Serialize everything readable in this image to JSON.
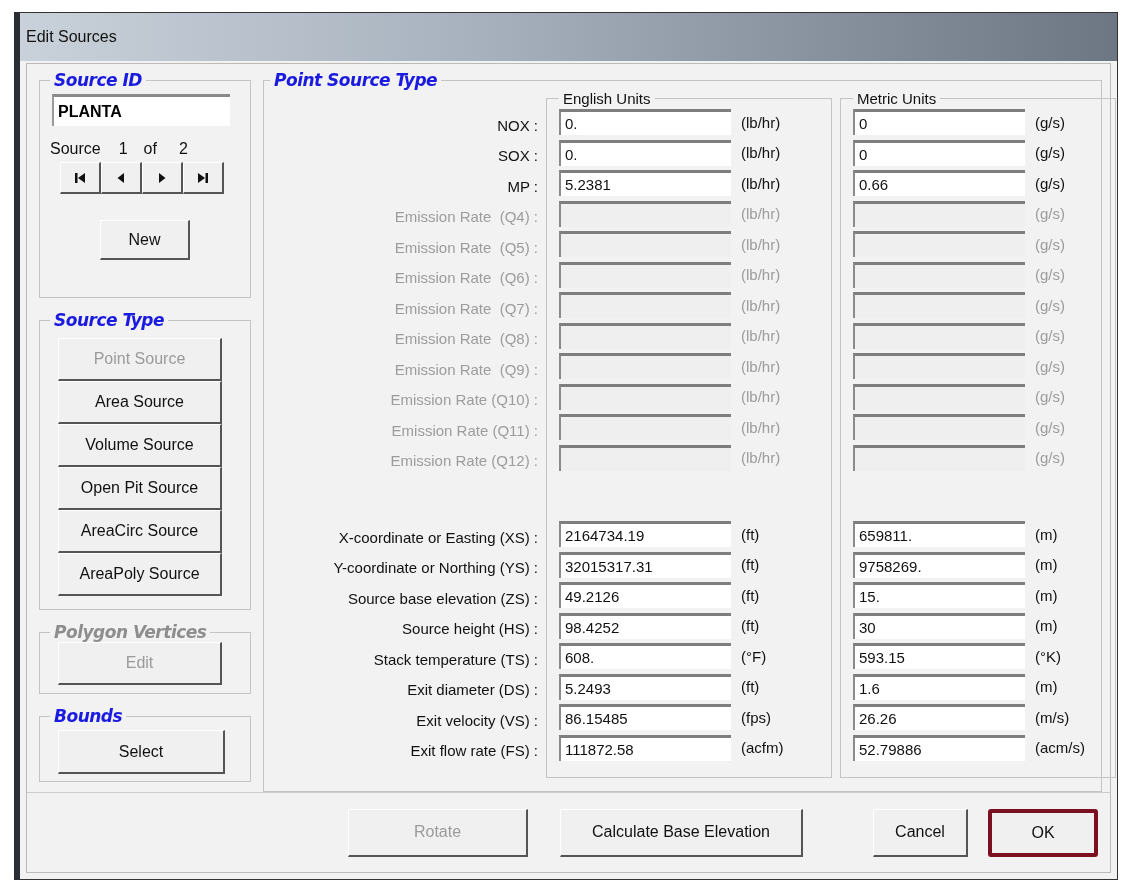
{
  "window": {
    "title": "Edit Sources"
  },
  "source_id": {
    "legend": "Source ID",
    "value": "PLANTA",
    "counter": {
      "label": "Source",
      "current": "1",
      "separator": "of",
      "total": "2"
    },
    "nav_buttons": [
      {
        "kind": "first"
      },
      {
        "kind": "prev"
      },
      {
        "kind": "next"
      },
      {
        "kind": "last"
      }
    ],
    "new_button": "New"
  },
  "source_type": {
    "legend": "Source Type",
    "buttons": [
      {
        "label": "Point Source",
        "disabled": true
      },
      {
        "label": "Area Source",
        "disabled": false
      },
      {
        "label": "Volume Source",
        "disabled": false
      },
      {
        "label": "Open Pit Source",
        "disabled": false
      },
      {
        "label": "AreaCirc Source",
        "disabled": false
      },
      {
        "label": "AreaPoly Source",
        "disabled": false
      }
    ]
  },
  "polygon_vertices": {
    "legend": "Polygon Vertices",
    "disabled": true,
    "button": "Edit"
  },
  "bounds": {
    "legend": "Bounds",
    "button": "Select"
  },
  "point_source": {
    "legend": "Point Source Type",
    "english_legend": "English Units",
    "metric_legend": "Metric Units",
    "emission_rows": [
      {
        "label": "NOX :",
        "english": "0.",
        "english_unit": "(lb/hr)",
        "metric": "0",
        "metric_unit": "(g/s)",
        "disabled": false
      },
      {
        "label": "SOX :",
        "english": "0.",
        "english_unit": "(lb/hr)",
        "metric": "0",
        "metric_unit": "(g/s)",
        "disabled": false
      },
      {
        "label": "MP :",
        "english": "5.2381",
        "english_unit": "(lb/hr)",
        "metric": "0.66",
        "metric_unit": "(g/s)",
        "disabled": false
      },
      {
        "label": "Emission Rate  (Q4) :",
        "english_unit": "(lb/hr)",
        "metric_unit": "(g/s)",
        "disabled": true
      },
      {
        "label": "Emission Rate  (Q5) :",
        "english_unit": "(lb/hr)",
        "metric_unit": "(g/s)",
        "disabled": true
      },
      {
        "label": "Emission Rate  (Q6) :",
        "english_unit": "(lb/hr)",
        "metric_unit": "(g/s)",
        "disabled": true
      },
      {
        "label": "Emission Rate  (Q7) :",
        "english_unit": "(lb/hr)",
        "metric_unit": "(g/s)",
        "disabled": true
      },
      {
        "label": "Emission Rate  (Q8) :",
        "english_unit": "(lb/hr)",
        "metric_unit": "(g/s)",
        "disabled": true
      },
      {
        "label": "Emission Rate  (Q9) :",
        "english_unit": "(lb/hr)",
        "metric_unit": "(g/s)",
        "disabled": true
      },
      {
        "label": "Emission Rate (Q10) :",
        "english_unit": "(lb/hr)",
        "metric_unit": "(g/s)",
        "disabled": true
      },
      {
        "label": "Emission Rate (Q11) :",
        "english_unit": "(lb/hr)",
        "metric_unit": "(g/s)",
        "disabled": true
      },
      {
        "label": "Emission Rate (Q12) :",
        "english_unit": "(lb/hr)",
        "metric_unit": "(g/s)",
        "disabled": true
      }
    ],
    "parameter_rows": [
      {
        "label": "X-coordinate or Easting (XS) :",
        "english": "2164734.19",
        "english_unit": "(ft)",
        "metric": "659811.",
        "metric_unit": "(m)"
      },
      {
        "label": "Y-coordinate or Northing (YS) :",
        "english": "32015317.31",
        "english_unit": "(ft)",
        "metric": "9758269.",
        "metric_unit": "(m)"
      },
      {
        "label": "Source base elevation (ZS) :",
        "english": "49.2126",
        "english_unit": "(ft)",
        "metric": "15.",
        "metric_unit": "(m)"
      },
      {
        "label": "Source height (HS) :",
        "english": "98.4252",
        "english_unit": "(ft)",
        "metric": "30",
        "metric_unit": "(m)"
      },
      {
        "label": "Stack temperature (TS) :",
        "english": "608.",
        "english_unit": "(°F)",
        "metric": "593.15",
        "metric_unit": "(°K)"
      },
      {
        "label": "Exit diameter (DS) :",
        "english": "5.2493",
        "english_unit": "(ft)",
        "metric": "1.6",
        "metric_unit": "(m)"
      },
      {
        "label": "Exit velocity (VS) :",
        "english": "86.15485",
        "english_unit": "(fps)",
        "metric": "26.26",
        "metric_unit": "(m/s)"
      },
      {
        "label": "Exit flow rate (FS) :",
        "english": "111872.58",
        "english_unit": "(acfm)",
        "metric": "52.79886",
        "metric_unit": "(acm/s)"
      }
    ]
  },
  "buttons": [
    {
      "label": "Rotate",
      "disabled": true,
      "focused": false
    },
    {
      "label": "Calculate Base Elevation",
      "disabled": false,
      "focused": false
    },
    {
      "label": "Cancel",
      "disabled": false,
      "focused": false
    },
    {
      "label": "OK",
      "disabled": false,
      "focused": true
    }
  ]
}
